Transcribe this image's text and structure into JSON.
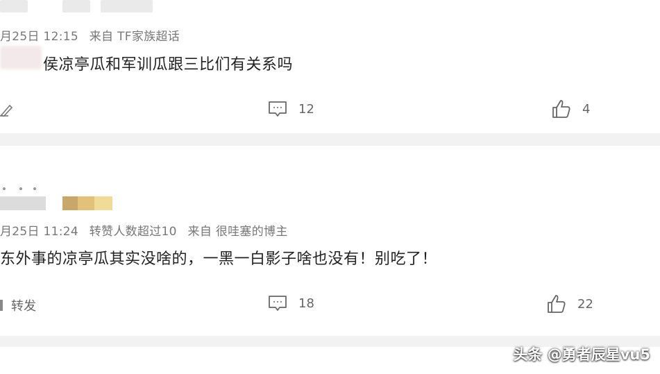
{
  "comment1": {
    "meta_date": "月25日 12:15",
    "meta_source": "来自 TF家族超话",
    "text": "凉亭瓜和军训瓜跟三比们有关系吗",
    "text_prefix": "侯",
    "reply_count": "12",
    "like_count": "4"
  },
  "comment2": {
    "meta_date": "月25日 11:24",
    "meta_repost": "转赞人数超过10",
    "meta_source": "来自 很哇塞的博主",
    "text": "东外事的凉亭瓜其实没啥的，一黑一白影子啥也没有！别吃了！",
    "repost_label": "转发",
    "reply_count": "18",
    "like_count": "22"
  },
  "watermark": "头条 @勇者辰星vu5",
  "colors": {
    "divider": "#f2f2f2",
    "meta": "#777777",
    "text": "#222222"
  }
}
